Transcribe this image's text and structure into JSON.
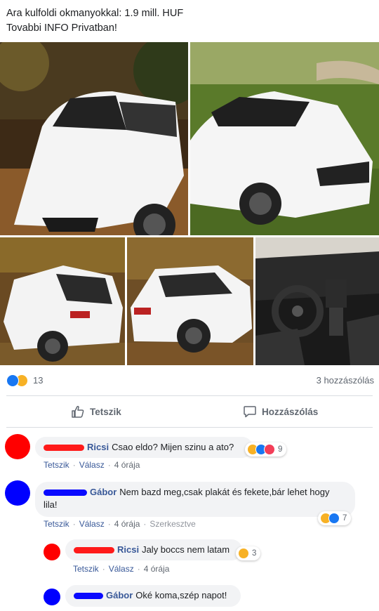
{
  "post": {
    "line1": "Ara kulfoldi okmanyokkal: 1.9 mill. HUF",
    "line2": "Tovabbi INFO Privatban!"
  },
  "photos": [
    {
      "subject": "white-station-wagon-front-autumn-leaves"
    },
    {
      "subject": "white-station-wagon-front-grass"
    },
    {
      "subject": "white-station-wagon-rear-left"
    },
    {
      "subject": "white-station-wagon-rear-right"
    },
    {
      "subject": "car-interior-dashboard"
    }
  ],
  "reactions": {
    "icons": [
      "like-icon",
      "wow-icon"
    ],
    "count": "13",
    "comments_label": "3 hozzászólás"
  },
  "actions": {
    "like_label": "Tetszik",
    "comment_label": "Hozzászólás"
  },
  "comments": [
    {
      "author": "Ricsi",
      "text": "Csao eldo? Mijen szinu a ato?",
      "avatar_color": "#ff0000",
      "redact_color": "#ff1a1a",
      "like": "Tetszik",
      "reply": "Válasz",
      "time": "4 órája",
      "reaction_count": "9"
    },
    {
      "author": "Gábor",
      "text_line1": "Nem bazd meg,csak plakát és fekete,bár lehet hogy",
      "text_line2": "lila!",
      "avatar_color": "#0000ff",
      "redact_color": "#0a0aff",
      "like": "Tetszik",
      "reply": "Válasz",
      "time": "4 órája",
      "edited": "Szerkesztve",
      "reaction_count": "7"
    },
    {
      "author": "Ricsi",
      "text": "Jaly boccs nem latam",
      "avatar_color": "#ff0000",
      "redact_color": "#ff1a1a",
      "like": "Tetszik",
      "reply": "Válasz",
      "time": "4 órája",
      "reaction_count": "3"
    },
    {
      "author": "Gábor",
      "text": "Oké koma,szép napot!",
      "avatar_color": "#0000ff",
      "redact_color": "#0a0aff"
    }
  ],
  "colors": {
    "link_blue": "#385898",
    "meta_grey": "#606770",
    "bubble_bg": "#f2f3f5",
    "like_blue": "#1877f2"
  }
}
